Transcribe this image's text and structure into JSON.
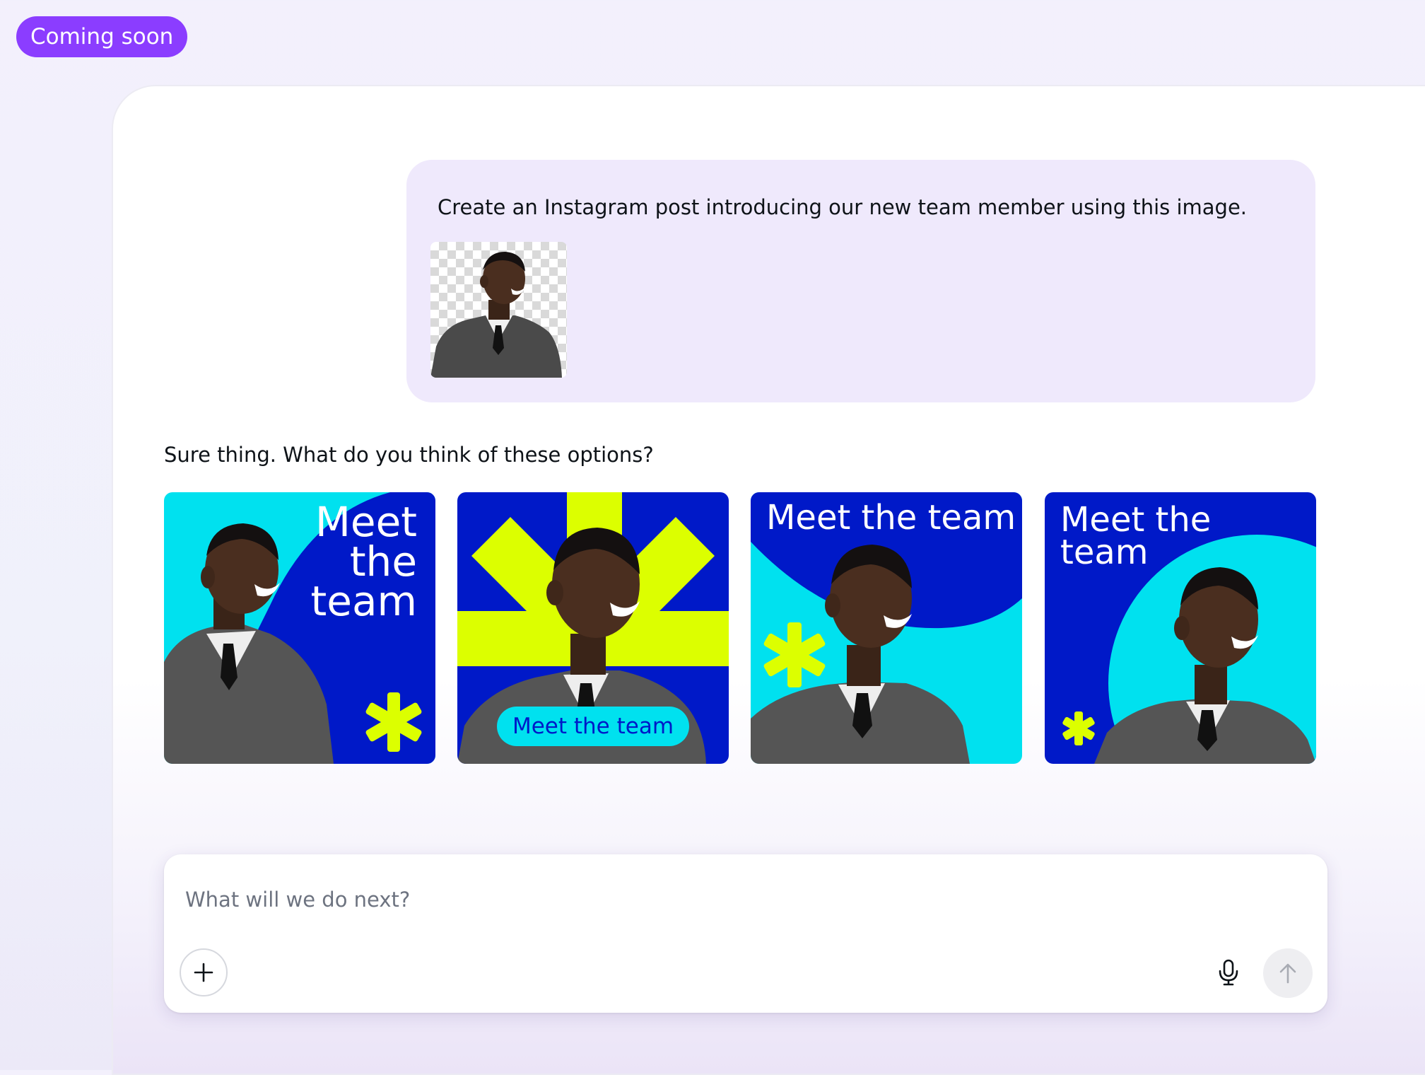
{
  "badge": {
    "label": "Coming soon"
  },
  "conversation": {
    "user_message": {
      "text": "Create an Instagram post introducing our new team member using this image.",
      "attachment_icon": "person-photo"
    },
    "assistant_reply": "Sure thing. What do you think of these options?",
    "design_options": [
      {
        "headline_lines": [
          "Meet",
          "the",
          "team"
        ],
        "background": "#0019c8",
        "accent": "#00e1ef",
        "highlight": "#dcff00"
      },
      {
        "headline": "Meet the team",
        "background": "#0019c8",
        "accent": "#00e1ef",
        "highlight": "#dcff00"
      },
      {
        "headline": "Meet the team",
        "background": "#00e1ef",
        "accent": "#0019c8",
        "highlight": "#dcff00"
      },
      {
        "headline_lines": [
          "Meet the",
          "team"
        ],
        "background": "#0019c8",
        "accent": "#00e1ef",
        "highlight": "#dcff00"
      }
    ]
  },
  "composer": {
    "placeholder": "What will we do next?",
    "add_icon": "plus-icon",
    "mic_icon": "microphone-icon",
    "send_icon": "arrow-up-icon"
  },
  "colors": {
    "brand_purple": "#8b3dff",
    "message_bubble": "#efe9fc",
    "royal_blue": "#0019c8",
    "cyan": "#00e1ef",
    "lime": "#dcff00"
  }
}
